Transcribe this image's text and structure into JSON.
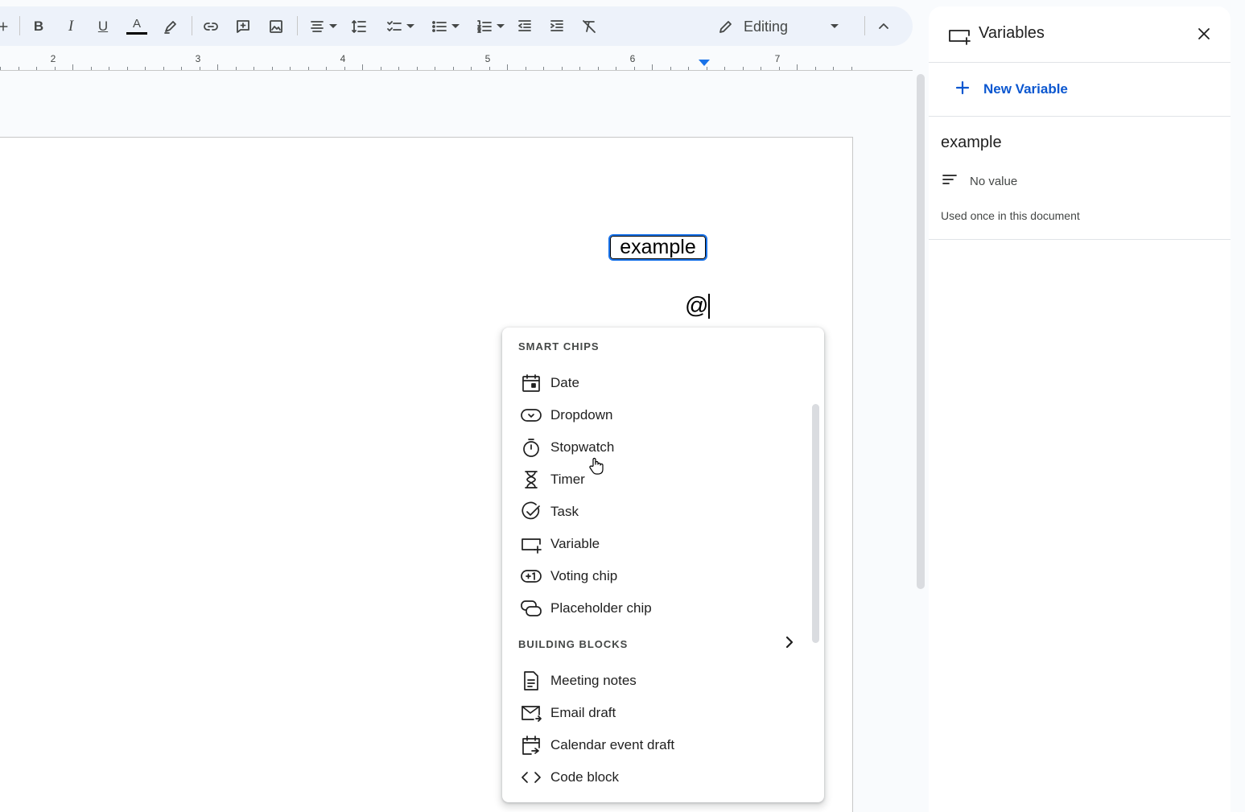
{
  "toolbar": {
    "mode": {
      "label": "Editing",
      "icon": "pencil-icon"
    },
    "buttons": [
      {
        "name": "bold",
        "icon": "bold-icon",
        "glyph": "B"
      },
      {
        "name": "italic",
        "icon": "italic-icon",
        "glyph": "I"
      },
      {
        "name": "underline",
        "icon": "underline-icon",
        "glyph": "U"
      },
      {
        "name": "text-color",
        "icon": "text-color-icon",
        "glyph": "A"
      }
    ]
  },
  "ruler": {
    "numbers": [
      "2",
      "3",
      "4",
      "5",
      "6",
      "7"
    ]
  },
  "document": {
    "variable_chip": "example",
    "typed_text": "@"
  },
  "menu": {
    "smart_chips_title": "SMART CHIPS",
    "smart_chips": [
      {
        "label": "Date",
        "icon": "calendar-icon"
      },
      {
        "label": "Dropdown",
        "icon": "dropdown-chip-icon"
      },
      {
        "label": "Stopwatch",
        "icon": "stopwatch-icon"
      },
      {
        "label": "Timer",
        "icon": "hourglass-icon"
      },
      {
        "label": "Task",
        "icon": "task-check-icon"
      },
      {
        "label": "Variable",
        "icon": "variable-icon"
      },
      {
        "label": "Voting chip",
        "icon": "voting-chip-icon"
      },
      {
        "label": "Placeholder chip",
        "icon": "placeholder-chip-icon"
      }
    ],
    "building_blocks_title": "BUILDING BLOCKS",
    "building_blocks": [
      {
        "label": "Meeting notes",
        "icon": "document-icon"
      },
      {
        "label": "Email draft",
        "icon": "email-icon"
      },
      {
        "label": "Calendar event draft",
        "icon": "calendar-event-icon"
      },
      {
        "label": "Code block",
        "icon": "code-icon"
      }
    ]
  },
  "panel": {
    "title": "Variables",
    "new_variable_label": "New Variable",
    "variable": {
      "name": "example",
      "value_text": "No value",
      "usage_text": "Used once in this document"
    }
  },
  "colors": {
    "accent": "#0b57d0",
    "toolbar_bg": "#edf2fa",
    "highlight": "#1a73e8"
  }
}
